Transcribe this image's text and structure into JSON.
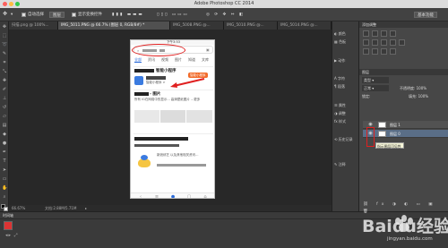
{
  "window": {
    "title": "Adobe Photoshop CC 2014"
  },
  "options_bar": {
    "auto_select_label": "自动选择",
    "auto_select_value": "图层",
    "show_transform_label": "显示变换控件",
    "workspace": "基本功能"
  },
  "tabs": [
    {
      "label": "扫描.png @ 100%..."
    },
    {
      "label": "IMG_5011.PNG @ 66.7% (图层 0, RGB/8#) *"
    },
    {
      "label": "IMG_5008.PNG @..."
    },
    {
      "label": "IMG_5010.PNG @..."
    },
    {
      "label": "IMG_5014.PNG @..."
    }
  ],
  "doc_status": {
    "zoom": "66.67%",
    "doc_size": "文档:2.88M/5.71M"
  },
  "timeline": {
    "label": "时间轴"
  },
  "phone": {
    "status_time": "下午3:53",
    "tabs": [
      "全部",
      "资讯",
      "视频",
      "图片",
      "知道",
      "文库"
    ],
    "section1_title": "智能小程序",
    "section1_text": "智能小程序 >",
    "badge": "智能小程序",
    "section2_title": "- 图片",
    "section2_text": "所有 IG在网络中的显示... 高清壁纸图片 ...更多",
    "section3_text": "新浪综艺 以及其他相关资讯..."
  },
  "panel_column": {
    "items": [
      "颜色",
      "色板",
      "动作",
      "字符",
      "段落",
      "属性",
      "调整",
      "样式",
      "历史记录",
      "注释"
    ]
  },
  "right_panel": {
    "adjust_header": "添加调整",
    "layers_header": "图层",
    "kind_label": "类型",
    "blend_mode": "正常",
    "opacity_label": "不透明度: 100%",
    "lock_label": "锁定:",
    "fill_label": "填充: 100%",
    "layers": [
      {
        "name": "图层 1"
      },
      {
        "name": "图层 0"
      }
    ],
    "tooltip": "指示图层可见性"
  },
  "watermark": {
    "text": "Baidu经验",
    "sub": "jingyan.baidu.com"
  },
  "colors": {
    "accent_red": "#e02020",
    "selected_layer": "#5a6e87"
  }
}
